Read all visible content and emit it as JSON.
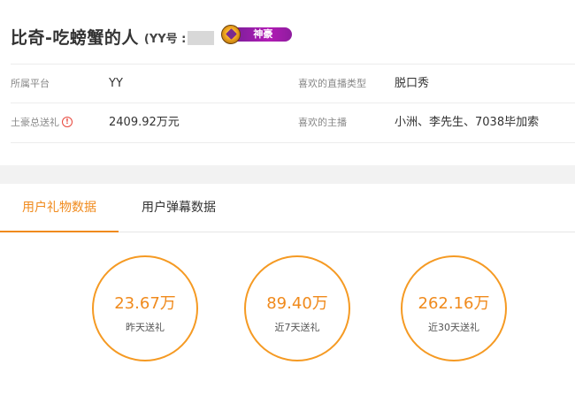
{
  "profile": {
    "name": "比奇-吃螃蟹的人",
    "yy_prefix": "(YY号 :",
    "rank_label": "神豪"
  },
  "info": {
    "platform_label": "所属平台",
    "platform_value": "YY",
    "live_type_label": "喜欢的直播类型",
    "live_type_value": "脱口秀",
    "total_gift_label": "土豪总送礼",
    "total_gift_value": "2409.92万元",
    "fav_anchor_label": "喜欢的主播",
    "fav_anchor_value": "小洲、李先生、7038毕加索"
  },
  "tabs": [
    {
      "label": "用户礼物数据",
      "active": true
    },
    {
      "label": "用户弹幕数据",
      "active": false
    }
  ],
  "stats": [
    {
      "value": "23.67万",
      "label": "昨天送礼"
    },
    {
      "value": "89.40万",
      "label": "近7天送礼"
    },
    {
      "value": "262.16万",
      "label": "近30天送礼"
    }
  ],
  "colors": {
    "accent": "#f08a1c",
    "badge": "#a21ab0",
    "warning": "#e8473c"
  }
}
